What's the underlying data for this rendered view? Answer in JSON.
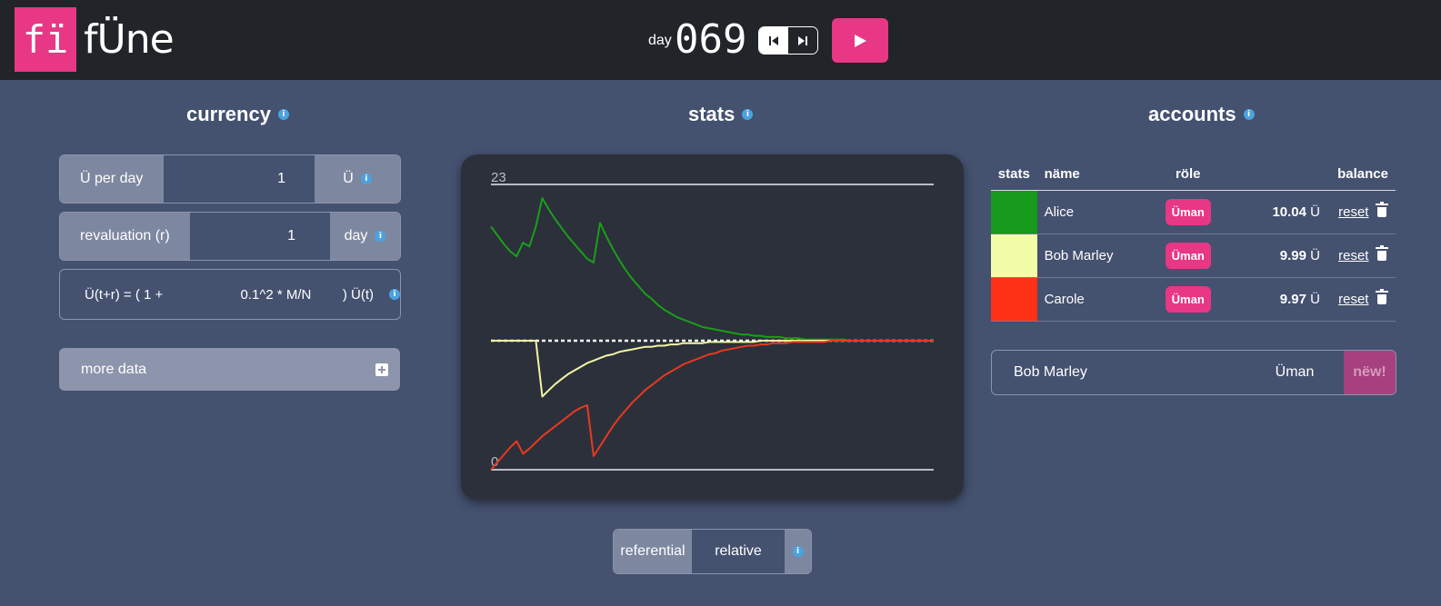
{
  "app": {
    "logo_glyph": "fï",
    "name": "fÜne"
  },
  "header": {
    "day_label": "day",
    "day_value": "069",
    "step_prev_icon": "skip-back-icon",
    "step_next_icon": "skip-forward-icon",
    "play_icon": "play-icon"
  },
  "currency": {
    "title": "currency",
    "per_day": {
      "label": "Ü per day",
      "value": "1",
      "unit": "Ü"
    },
    "revaluation": {
      "label": "revaluation (r)",
      "value": "1",
      "unit": "day"
    },
    "formula": {
      "left": "Ü(t+r) = ( 1 +",
      "value": "0.1^2 * M/N",
      "right": ") Ü(t)"
    },
    "more_data_label": "more data"
  },
  "stats": {
    "title": "stats",
    "toggle": {
      "referential": "referential",
      "relative": "relative"
    }
  },
  "chart_data": {
    "type": "line",
    "y_top_label": "23",
    "y_bottom_label": "0",
    "ylim": [
      0,
      23
    ],
    "x": [
      0,
      1,
      2,
      3,
      4,
      5,
      6,
      7,
      8,
      9,
      10,
      11,
      12,
      13,
      14,
      15,
      16,
      17,
      18,
      19,
      20,
      21,
      22,
      23,
      24,
      25,
      26,
      27,
      28,
      29,
      30,
      31,
      32,
      33,
      34,
      35,
      36,
      37,
      38,
      39,
      40,
      41,
      42,
      43,
      44,
      45,
      46,
      47,
      48,
      49,
      50,
      51,
      52,
      53,
      54,
      55,
      56,
      57,
      58,
      59,
      60,
      61,
      62,
      63,
      64,
      65,
      66,
      67,
      68,
      69
    ],
    "series": [
      {
        "color": "#1a9e1a",
        "values": [
          19.6,
          18.9,
          18.2,
          17.6,
          17.2,
          18.3,
          18.0,
          19.6,
          21.9,
          21.0,
          20.2,
          19.5,
          18.8,
          18.2,
          17.6,
          17.0,
          16.7,
          19.9,
          18.8,
          17.8,
          16.9,
          16.1,
          15.4,
          14.8,
          14.2,
          13.8,
          13.3,
          12.9,
          12.6,
          12.3,
          12.1,
          11.9,
          11.7,
          11.5,
          11.4,
          11.3,
          11.2,
          11.1,
          11.0,
          10.9,
          10.9,
          10.8,
          10.8,
          10.7,
          10.7,
          10.7,
          10.6,
          10.6,
          10.6,
          10.5,
          10.5,
          10.5,
          10.5,
          10.5,
          10.5,
          10.5,
          10.4,
          10.4,
          10.4,
          10.4,
          10.4,
          10.4,
          10.4,
          10.4,
          10.4,
          10.4,
          10.4,
          10.4,
          10.4,
          10.4
        ]
      },
      {
        "color": "#f2f5a2",
        "values": [
          10.4,
          10.4,
          10.4,
          10.4,
          10.4,
          10.4,
          10.4,
          10.4,
          5.9,
          6.4,
          6.9,
          7.3,
          7.7,
          8.0,
          8.3,
          8.6,
          8.8,
          9.0,
          9.2,
          9.3,
          9.5,
          9.6,
          9.7,
          9.8,
          9.9,
          9.9,
          10.0,
          10.0,
          10.1,
          10.1,
          10.2,
          10.2,
          10.2,
          10.2,
          10.3,
          10.3,
          10.3,
          10.3,
          10.3,
          10.3,
          10.3,
          10.3,
          10.4,
          10.4,
          10.4,
          10.4,
          10.4,
          10.4,
          10.4,
          10.4,
          10.4,
          10.4,
          10.4,
          10.4,
          10.4,
          10.4,
          10.4,
          10.4,
          10.4,
          10.4,
          10.4,
          10.4,
          10.4,
          10.4,
          10.4,
          10.4,
          10.4,
          10.4,
          10.4,
          10.4
        ]
      },
      {
        "color": "#e8391e",
        "values": [
          0.0,
          0.6,
          1.2,
          1.8,
          2.3,
          1.3,
          1.7,
          2.2,
          2.7,
          3.1,
          3.5,
          3.9,
          4.3,
          4.7,
          5.0,
          5.2,
          1.1,
          1.9,
          2.7,
          3.5,
          4.2,
          4.8,
          5.4,
          5.9,
          6.4,
          6.8,
          7.2,
          7.6,
          7.9,
          8.2,
          8.5,
          8.7,
          8.9,
          9.1,
          9.3,
          9.4,
          9.6,
          9.7,
          9.8,
          9.9,
          10.0,
          10.0,
          10.1,
          10.1,
          10.2,
          10.2,
          10.2,
          10.3,
          10.3,
          10.3,
          10.3,
          10.3,
          10.3,
          10.4,
          10.4,
          10.4,
          10.4,
          10.4,
          10.4,
          10.4,
          10.4,
          10.4,
          10.4,
          10.4,
          10.4,
          10.4,
          10.4,
          10.4,
          10.4,
          10.4
        ]
      }
    ],
    "average_line": {
      "value": 10.4,
      "style": "dashed",
      "color": "#ffffff"
    }
  },
  "accounts": {
    "title": "accounts",
    "headers": {
      "stats": "stats",
      "name": "näme",
      "role": "röle",
      "balance": "balance"
    },
    "rows": [
      {
        "color": "#159a1b",
        "name": "Alice",
        "role": "Üman",
        "balance": "10.04",
        "unit": "Ü",
        "reset": "reset"
      },
      {
        "color": "#f3fda7",
        "name": "Bob Marley",
        "role": "Üman",
        "balance": "9.99",
        "unit": "Ü",
        "reset": "reset"
      },
      {
        "color": "#ff3217",
        "name": "Carole",
        "role": "Üman",
        "balance": "9.97",
        "unit": "Ü",
        "reset": "reset"
      }
    ],
    "new_account": {
      "name_value": "Bob Marley",
      "role_value": "Üman",
      "button_label": "nëw!"
    }
  },
  "icons": {
    "info": "info-icon",
    "plus": "plus-square-icon",
    "trash": "trash-icon"
  }
}
